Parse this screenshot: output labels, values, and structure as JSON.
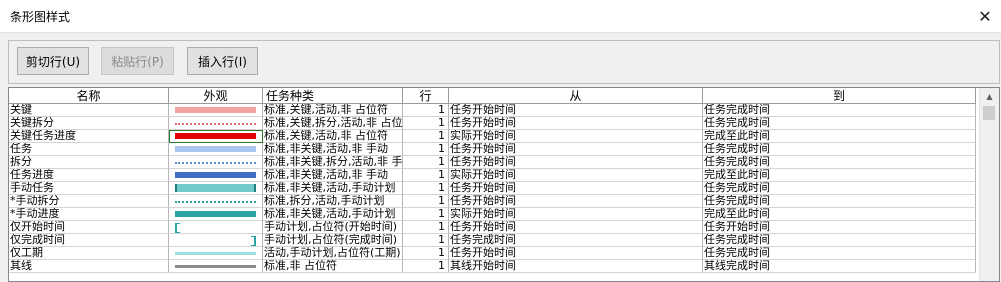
{
  "window": {
    "title": "条形图样式",
    "close_glyph": "✕"
  },
  "toolbar": {
    "cut_row": "剪切行(U)",
    "paste_row": "粘贴行(P)",
    "insert_row": "插入行(I)"
  },
  "table": {
    "headers": {
      "name": "名称",
      "appearance": "外观",
      "task_type": "任务种类",
      "row": "行",
      "from": "从",
      "to": "到"
    },
    "rows": [
      {
        "name": "关键",
        "task_type": "标准,关键,活动,非 占位符",
        "row": "1",
        "from": "任务开始时间",
        "to": "任务完成时间",
        "appearance": {
          "style": "thick",
          "color": "#f4a3a3"
        }
      },
      {
        "name": "关键拆分",
        "task_type": "标准,关键,拆分,活动,非 占位符",
        "row": "1",
        "from": "任务开始时间",
        "to": "任务完成时间",
        "appearance": {
          "style": "dotted",
          "color": "#e36b6b"
        }
      },
      {
        "name": "关键任务进度",
        "task_type": "标准,关键,活动,非 占位符",
        "row": "1",
        "from": "实际开始时间",
        "to": "完成至此时间",
        "appearance": {
          "style": "thick",
          "color": "#e00000"
        }
      },
      {
        "name": "任务",
        "task_type": "标准,非关键,活动,非 手动",
        "row": "1",
        "from": "任务开始时间",
        "to": "任务完成时间",
        "appearance": {
          "style": "thick",
          "color": "#a9c7ee"
        }
      },
      {
        "name": "拆分",
        "task_type": "标准,非关键,拆分,活动,非 手动",
        "row": "1",
        "from": "任务开始时间",
        "to": "任务完成时间",
        "appearance": {
          "style": "dotted",
          "color": "#5b8fd6"
        }
      },
      {
        "name": "任务进度",
        "task_type": "标准,非关键,活动,非 手动",
        "row": "1",
        "from": "实际开始时间",
        "to": "完成至此时间",
        "appearance": {
          "style": "thick",
          "color": "#3f6fc4"
        }
      },
      {
        "name": "手动任务",
        "task_type": "标准,非关键,活动,手动计划",
        "row": "1",
        "from": "任务开始时间",
        "to": "任务完成时间",
        "appearance": {
          "style": "bracket",
          "color": "#71c9c9"
        }
      },
      {
        "name": "*手动拆分",
        "task_type": "标准,拆分,活动,手动计划",
        "row": "1",
        "from": "任务开始时间",
        "to": "任务完成时间",
        "appearance": {
          "style": "dotted",
          "color": "#2aa3a3"
        }
      },
      {
        "name": "*手动进度",
        "task_type": "标准,非关键,活动,手动计划",
        "row": "1",
        "from": "实际开始时间",
        "to": "完成至此时间",
        "appearance": {
          "style": "thick",
          "color": "#2aa3a3"
        }
      },
      {
        "name": "仅开始时间",
        "task_type": "手动计划,占位符(开始时间)",
        "row": "1",
        "from": "任务开始时间",
        "to": "任务开始时间",
        "appearance": {
          "style": "start",
          "color": "#2aa3a3"
        }
      },
      {
        "name": "仅完成时间",
        "task_type": "手动计划,占位符(完成时间)",
        "row": "1",
        "from": "任务完成时间",
        "to": "任务完成时间",
        "appearance": {
          "style": "finish",
          "color": "#2aa3a3"
        }
      },
      {
        "name": "仅工期",
        "task_type": "活动,手动计划,占位符(工期)",
        "row": "1",
        "from": "任务开始时间",
        "to": "任务完成时间",
        "appearance": {
          "style": "thin",
          "color": "#9adede"
        }
      },
      {
        "name": "其线",
        "task_type": "标准,非 占位符",
        "row": "1",
        "from": "其线开始时间",
        "to": "其线完成时间",
        "appearance": {
          "style": "thin",
          "color": "#8a8a8a"
        }
      }
    ],
    "selected_row": 2
  }
}
